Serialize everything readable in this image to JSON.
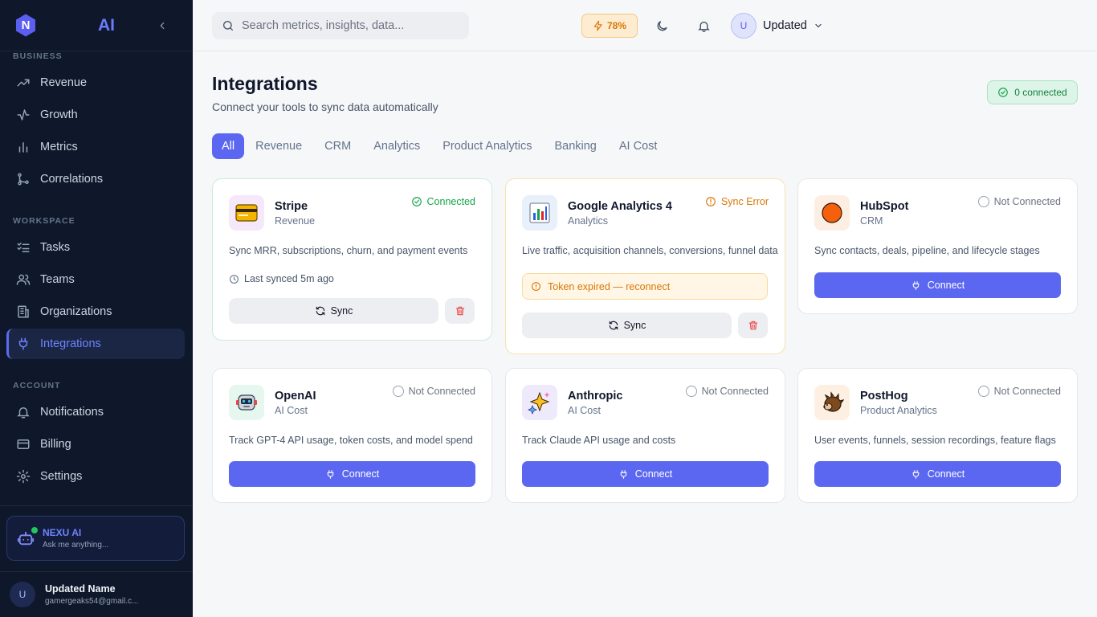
{
  "sidebar": {
    "logo_letter": "N",
    "brand": "AI",
    "sections": {
      "business": "BUSINESS",
      "workspace": "WORKSPACE",
      "account": "ACCOUNT"
    },
    "items": [
      {
        "label": "Revenue",
        "icon": "trending-up-icon"
      },
      {
        "label": "Growth",
        "icon": "activity-icon"
      },
      {
        "label": "Metrics",
        "icon": "bar-chart-icon"
      },
      {
        "label": "Correlations",
        "icon": "git-branch-icon"
      },
      {
        "label": "Tasks",
        "icon": "checklist-icon"
      },
      {
        "label": "Teams",
        "icon": "users-icon"
      },
      {
        "label": "Organizations",
        "icon": "building-icon"
      },
      {
        "label": "Integrations",
        "icon": "plug-icon",
        "active": true
      },
      {
        "label": "Notifications",
        "icon": "bell-icon"
      },
      {
        "label": "Billing",
        "icon": "credit-card-icon"
      },
      {
        "label": "Settings",
        "icon": "gear-icon"
      }
    ],
    "assistant": {
      "title": "NEXU AI",
      "subtitle": "Ask me anything..."
    },
    "user": {
      "initial": "U",
      "name": "Updated Name",
      "email": "gamergeaks54@gmail.c..."
    }
  },
  "header": {
    "search_placeholder": "Search metrics, insights, data...",
    "battery": "78%",
    "user": {
      "initial": "U",
      "name": "Updated"
    }
  },
  "main": {
    "title": "Integrations",
    "subtitle": "Connect your tools to sync data automatically",
    "connected_badge": "0 connected",
    "tabs": [
      "All",
      "Revenue",
      "CRM",
      "Analytics",
      "Product Analytics",
      "Banking",
      "AI Cost"
    ],
    "active_tab": "All",
    "cards": [
      {
        "name": "Stripe",
        "category": "Revenue",
        "status": "Connected",
        "description": "Sync MRR, subscriptions, churn, and payment events",
        "last_synced": "Last synced 5m ago",
        "sync_label": "Sync",
        "logo": "credit-card-emoji"
      },
      {
        "name": "Google Analytics 4",
        "category": "Analytics",
        "status": "Sync Error",
        "description": "Live traffic, acquisition channels, conversions, funnel data",
        "error": "Token expired — reconnect",
        "sync_label": "Sync",
        "logo": "bar-chart-emoji"
      },
      {
        "name": "HubSpot",
        "category": "CRM",
        "status": "Not Connected",
        "description": "Sync contacts, deals, pipeline, and lifecycle stages",
        "connect_label": "Connect",
        "logo": "orange-circle-emoji"
      },
      {
        "name": "OpenAI",
        "category": "AI Cost",
        "status": "Not Connected",
        "description": "Track GPT-4 API usage, token costs, and model spend",
        "connect_label": "Connect",
        "logo": "robot-emoji"
      },
      {
        "name": "Anthropic",
        "category": "AI Cost",
        "status": "Not Connected",
        "description": "Track Claude API usage and costs",
        "connect_label": "Connect",
        "logo": "sparkles-emoji"
      },
      {
        "name": "PostHog",
        "category": "Product Analytics",
        "status": "Not Connected",
        "description": "User events, funnels, session recordings, feature flags",
        "connect_label": "Connect",
        "logo": "hedgehog-emoji"
      }
    ]
  },
  "colors": {
    "sidebar_bg": "#0f172a",
    "accent": "#5b67f0",
    "success": "#16a34a",
    "warning": "#d97706",
    "danger": "#ef4444"
  }
}
